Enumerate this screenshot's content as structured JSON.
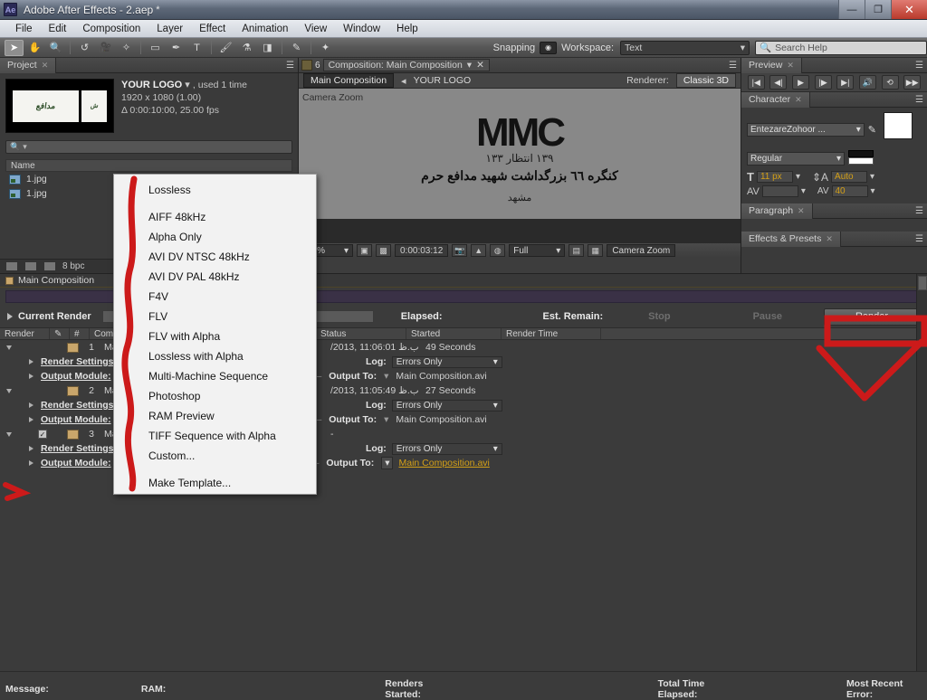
{
  "window": {
    "app_icon": "Ae",
    "title": "Adobe After Effects - 2.aep",
    "modified_marker": "*",
    "minimize": "—",
    "maximize": "❐",
    "close": "✕"
  },
  "menubar": {
    "items": [
      "File",
      "Edit",
      "Composition",
      "Layer",
      "Effect",
      "Animation",
      "View",
      "Window",
      "Help"
    ]
  },
  "toolbar": {
    "tools": [
      {
        "name": "selection-tool",
        "glyph": "➤"
      },
      {
        "name": "hand-tool",
        "glyph": "✋"
      },
      {
        "name": "zoom-tool",
        "glyph": "🔍"
      },
      {
        "name": "rotation-tool",
        "glyph": "↺"
      },
      {
        "name": "camera-tool",
        "glyph": "🎥"
      },
      {
        "name": "pan-behind-tool",
        "glyph": "✧"
      },
      {
        "name": "shape-tool",
        "glyph": "▭"
      },
      {
        "name": "pen-tool",
        "glyph": "✒"
      },
      {
        "name": "type-tool",
        "glyph": "T"
      },
      {
        "name": "brush-tool",
        "glyph": "🖌"
      },
      {
        "name": "clone-stamp-tool",
        "glyph": "⚗"
      },
      {
        "name": "eraser-tool",
        "glyph": "◨"
      },
      {
        "name": "roto-brush-tool",
        "glyph": "✎"
      },
      {
        "name": "puppet-tool",
        "glyph": "✦"
      }
    ],
    "snapping_label": "Snapping",
    "workspace_label": "Workspace:",
    "workspace_value": "Text",
    "search_placeholder": "Search Help"
  },
  "project_panel": {
    "tab_label": "Project",
    "asset_name": "YOUR LOGO",
    "used_text": ", used 1 time",
    "dimensions": "1920 x 1080 (1.00)",
    "duration": "Δ 0:00:10:00, 25.00 fps",
    "search_placeholder": "",
    "column_header": "Name",
    "files": [
      "1.jpg",
      "1.jpg"
    ],
    "bit_depth": "8 bpc"
  },
  "comp_panel": {
    "tab_label": "Composition: Main Composition",
    "active_comp": "Main Composition",
    "linked_comp": "YOUR LOGO",
    "renderer_label": "Renderer:",
    "renderer_value": "Classic 3D",
    "viewer_overlay": "Camera Zoom",
    "logo_text": "MMC",
    "logo_sub1": "١٣٩   انتظار   ١٣٣",
    "logo_sub2": "کنگره ٦٦ بزرگداشت شهید مدافع حرم",
    "logo_sub3": "مشهد",
    "zoom_level": "25%",
    "timecode": "0:00:03:12",
    "quality": "Full",
    "camera_label": "Camera Zoom"
  },
  "preview_panel": {
    "tab_label": "Preview",
    "controls": [
      {
        "name": "first-frame-button",
        "glyph": "|◀"
      },
      {
        "name": "previous-frame-button",
        "glyph": "◀|"
      },
      {
        "name": "play-button",
        "glyph": "▶"
      },
      {
        "name": "next-frame-button",
        "glyph": "|▶"
      },
      {
        "name": "last-frame-button",
        "glyph": "▶|"
      },
      {
        "name": "audio-toggle-button",
        "glyph": "🔊"
      },
      {
        "name": "loop-button",
        "glyph": "⟲"
      },
      {
        "name": "ram-preview-button",
        "glyph": "▶▶"
      }
    ]
  },
  "character_panel": {
    "tab_label": "Character",
    "font_family": "EntezareZohoor ...",
    "font_style": "Regular",
    "font_size": "11 px",
    "leading": "Auto",
    "tracking": "40",
    "size_icon_label": "T",
    "kerning_icon_label": "AV"
  },
  "paragraph_panel": {
    "tab_label": "Paragraph"
  },
  "effects_panel": {
    "tab_label": "Effects & Presets"
  },
  "render_queue": {
    "tab_label": "Main Composition",
    "current_render_label": "Current Render",
    "elapsed_label": "Elapsed:",
    "est_remain_label": "Est. Remain:",
    "stop_label": "Stop",
    "pause_label": "Pause",
    "render_label": "Render",
    "columns": [
      "Render",
      "#",
      "Comp Name",
      "Status",
      "Started",
      "Render Time"
    ],
    "items": [
      {
        "index": "1",
        "comp_name": "Main Composition",
        "started": "/2013, 11:06:01 ب.ظ",
        "render_time": "49 Seconds",
        "render_settings_label": "Render Settings:",
        "output_module_label": "Output Module:",
        "log_label": "Log:",
        "log_value": "Errors Only",
        "output_to_label": "Output To:",
        "output_to_value": "Main Composition.avi",
        "checked": false
      },
      {
        "index": "2",
        "comp_name": "Main Composition",
        "started": "/2013, 11:05:49 ب.ظ",
        "render_time": "27 Seconds",
        "render_settings_label": "Render Settings:",
        "output_module_label": "Output Module:",
        "log_label": "Log:",
        "log_value": "Errors Only",
        "output_to_label": "Output To:",
        "output_to_value": "Main Composition.avi",
        "checked": false
      },
      {
        "index": "3",
        "comp_name": "Main Composition",
        "started": "-",
        "render_time": "",
        "render_settings_label": "Render Settings:",
        "output_module_label": "Output Module:",
        "log_label": "Log:",
        "log_value": "Errors Only",
        "output_to_label": "Output To:",
        "output_to_value": "Main Composition.avi",
        "checked": true
      }
    ]
  },
  "output_module_menu": {
    "items": [
      "Lossless",
      "AIFF 48kHz",
      "Alpha Only",
      "AVI DV NTSC 48kHz",
      "AVI DV PAL 48kHz",
      "F4V",
      "FLV",
      "FLV with Alpha",
      "Lossless with Alpha",
      "Multi-Machine Sequence",
      "Photoshop",
      "RAM Preview",
      "TIFF Sequence with Alpha",
      "Custom..."
    ],
    "footer_item": "Make Template..."
  },
  "statusbar": {
    "message_label": "Message:",
    "ram_label": "RAM:",
    "renders_started_label": "Renders Started:",
    "total_time_label": "Total Time Elapsed:",
    "most_recent_error_label": "Most Recent Error:"
  },
  "annotations": {
    "color": "#cc1a1a",
    "marks": [
      "menu-underline-stroke",
      "render-button-box",
      "render-arrow",
      "output-module-pointer"
    ]
  }
}
